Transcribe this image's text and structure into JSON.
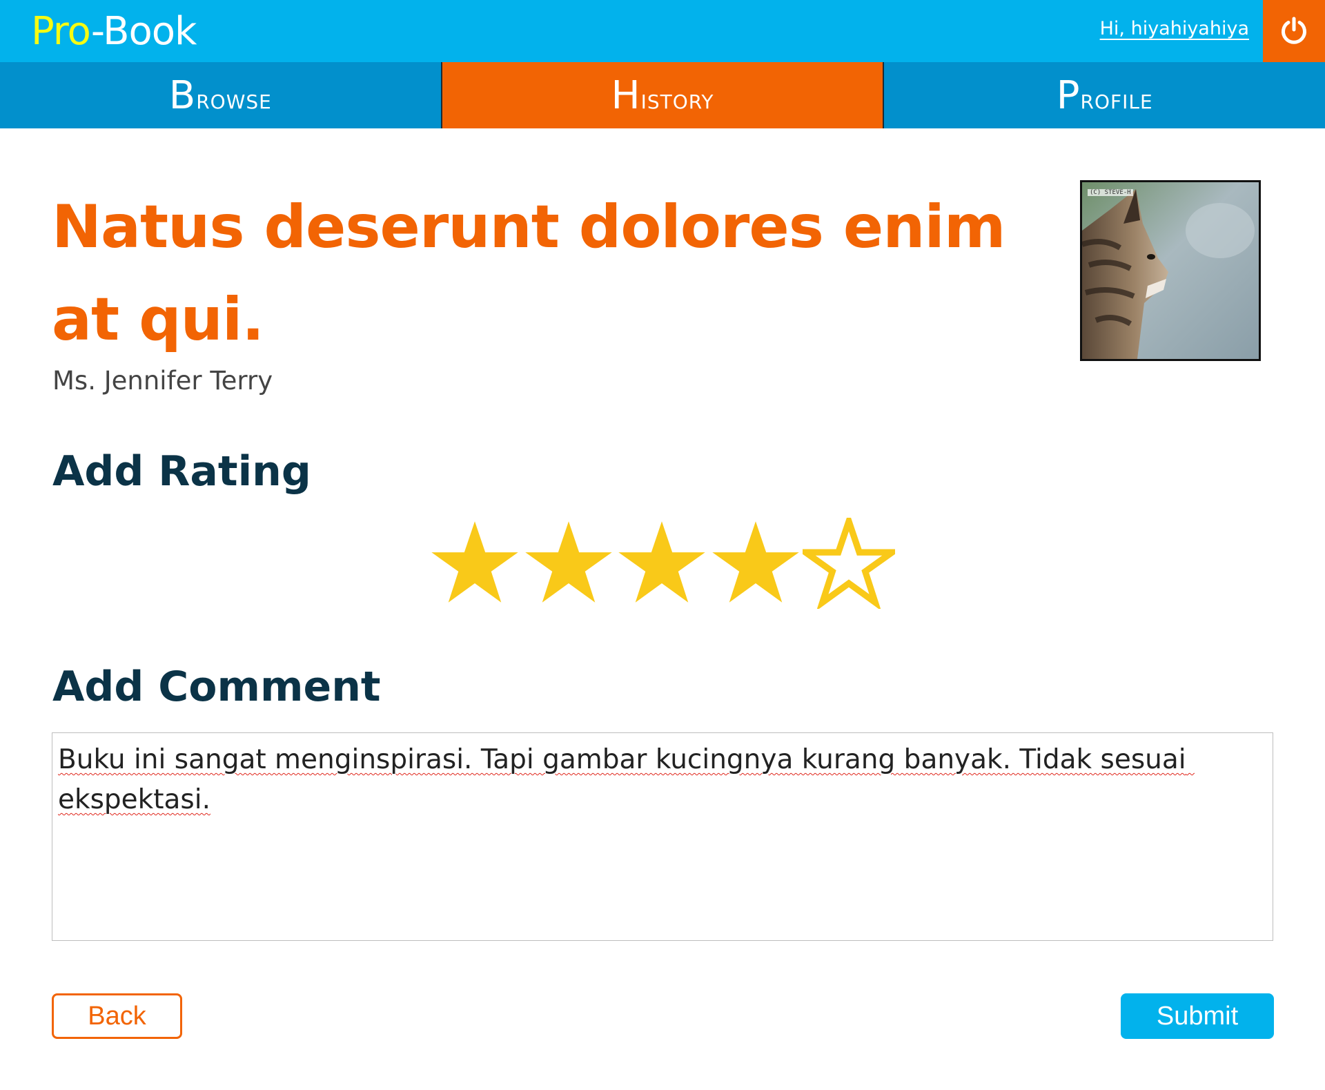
{
  "header": {
    "logo_pro": "Pro",
    "logo_rest": "-Book",
    "greeting": "Hi, hiyahiyahiya",
    "logout_icon": "power-icon",
    "colors": {
      "bar": "#02b2ec",
      "logo_accent": "#f6fb12",
      "logout_bg": "#f26404"
    }
  },
  "nav": {
    "tabs": [
      {
        "first": "B",
        "rest": "rowse",
        "active": false
      },
      {
        "first": "H",
        "rest": "istory",
        "active": true
      },
      {
        "first": "P",
        "rest": "rofile",
        "active": false
      }
    ],
    "colors": {
      "bar": "#0290cc",
      "active": "#f26404"
    }
  },
  "book": {
    "title": "Natus deserunt dolores enim at qui.",
    "author": "Ms. Jennifer Terry",
    "cover_watermark": "(C) STEVE-H",
    "title_color": "#f26404"
  },
  "rating": {
    "heading": "Add Rating",
    "value": 4,
    "max": 5,
    "star_color": "#f9c919"
  },
  "comment": {
    "heading": "Add Comment",
    "text": "Buku ini sangat menginspirasi. Tapi gambar kucingnya kurang banyak. Tidak sesuai ekspektasi."
  },
  "actions": {
    "back_label": "Back",
    "submit_label": "Submit",
    "colors": {
      "back": "#f26404",
      "submit": "#02b2ec"
    }
  }
}
